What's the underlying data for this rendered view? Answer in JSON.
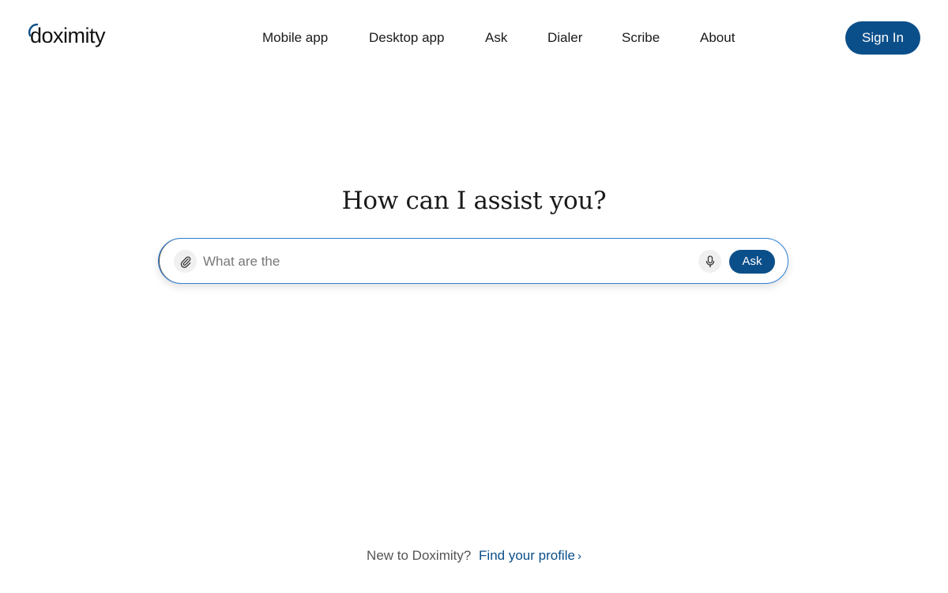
{
  "header": {
    "logo_text": "doximity",
    "nav": [
      {
        "label": "Mobile app"
      },
      {
        "label": "Desktop app"
      },
      {
        "label": "Ask"
      },
      {
        "label": "Dialer"
      },
      {
        "label": "Scribe"
      },
      {
        "label": "About"
      }
    ],
    "signin_label": "Sign In"
  },
  "hero": {
    "title": "How can I assist you?"
  },
  "search": {
    "value": "What are the",
    "attach_icon": "paperclip-icon",
    "mic_icon": "microphone-icon",
    "ask_label": "Ask"
  },
  "footer": {
    "prompt": "New to Doximity?",
    "link_label": "Find your profile",
    "chevron": "›"
  },
  "colors": {
    "brand": "#0b4f8a",
    "search_border": "#2f7fd6",
    "text": "#1a1a1a"
  }
}
